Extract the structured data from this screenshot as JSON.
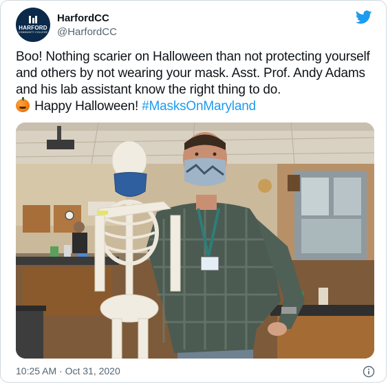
{
  "account": {
    "display_name": "HarfordCC",
    "handle": "@HarfordCC",
    "avatar_text": "HARFORD",
    "avatar_subtext": "COMMUNITY COLLEGE"
  },
  "tweet": {
    "text_main": "Boo! Nothing scarier on Halloween than not protecting yourself and others by not wearing your mask. Asst. Prof. Andy Adams and his lab assistant know the right thing to do.",
    "text_closing": " Happy Halloween! ",
    "hashtag": "#MasksOnMaryland",
    "emoji": "jack-o-lantern"
  },
  "timestamp": "10:25 AM · Oct 31, 2020",
  "icons": {
    "brand": "twitter-bird-icon",
    "info": "info-icon"
  },
  "colors": {
    "link": "#1d9bf0",
    "twitter_blue": "#1d9bf0",
    "text": "#0f1419",
    "muted": "#536471",
    "avatar_bg": "#0b2a4a"
  }
}
